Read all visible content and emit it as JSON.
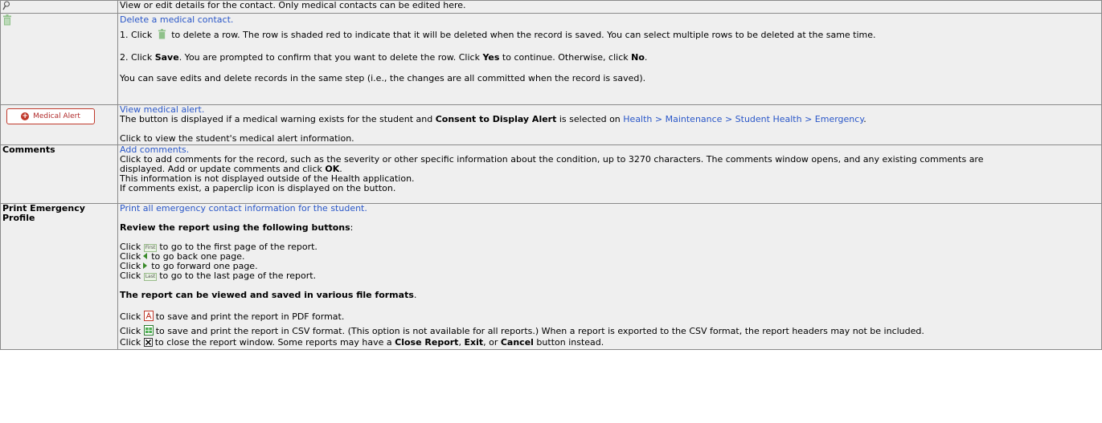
{
  "rows": {
    "view": {
      "icon": "magnifier-icon",
      "text": "View or edit details for the contact. Only medical contacts can be edited here."
    },
    "delete": {
      "icon": "trash-icon",
      "link": "Delete a medical contact.",
      "s1a": "1. Click",
      "s1b": "to delete a row. The row is shaded red to indicate that it will be deleted when the record is saved. You can select multiple rows to be deleted at the same time.",
      "s2a": "2. Click",
      "s2b": "Save",
      "s2c": ". You are prompted to confirm that you want to delete the row. Click",
      "s2d": "Yes",
      "s2e": "to continue. Otherwise, click",
      "s2f": "No",
      "s2g": ".",
      "note": "You can save edits and delete records in the same step (i.e., the changes are all committed when the record is saved)."
    },
    "alert": {
      "button_label": "Medical Alert",
      "link": "View medical alert.",
      "l1a": "The button is displayed if a medical warning exists for the student and",
      "l1b": "Consent to Display Alert",
      "l1c": "is selected on",
      "l1d": "Health > Maintenance > Student Health > Emergency",
      "l1e": ".",
      "l2": "Click to view the student's medical alert information."
    },
    "comments": {
      "label": "Comments",
      "link": "Add comments.",
      "l1": "Click to add comments for the record, such as the severity or other specific information about the condition, up to 3270 characters. The comments window opens, and any existing comments are",
      "l2a": "displayed. Add or update comments and click",
      "l2b": "OK",
      "l2c": ".",
      "l3": "This information is not displayed outside of the Health application.",
      "l4": "If comments exist, a paperclip icon is displayed on the button."
    },
    "print": {
      "label": "Print Emergency Profile",
      "link": "Print all emergency contact information for the student.",
      "review": "Review the report using the following buttons",
      "colon": ":",
      "click": "Click",
      "first_btn": "First",
      "first_txt": "to go to the first page of the report.",
      "back_txt": "to go back one page.",
      "fwd_txt": "to go forward one page.",
      "last_btn": "Last",
      "last_txt": "to go to the last page of the report.",
      "formats": "The report can be viewed and saved in various file formats",
      "period": ".",
      "pdf_txt": "to save and print the report in PDF format.",
      "csv_txt": "to save and print the report in CSV format. (This option is not available for all reports.) When a report is exported to the CSV format, the report headers may not be included.",
      "close_a": "to close the report window. Some reports may have a",
      "close_b": "Close Report",
      "close_c": ",",
      "close_d": "Exit",
      "close_e": ", or",
      "close_f": "Cancel",
      "close_g": "button instead."
    }
  }
}
